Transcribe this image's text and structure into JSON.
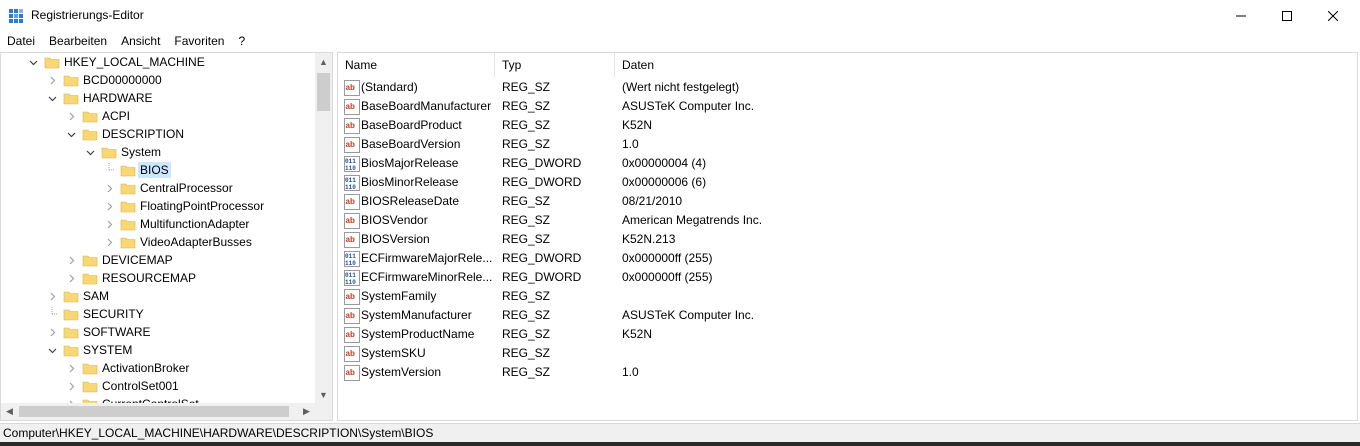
{
  "window": {
    "title": "Registrierungs-Editor",
    "icon": "regedit-icon"
  },
  "menu": [
    "Datei",
    "Bearbeiten",
    "Ansicht",
    "Favoriten",
    "?"
  ],
  "tree": {
    "items": [
      {
        "label": "HKEY_LOCAL_MACHINE",
        "level": 1,
        "state": "expanded"
      },
      {
        "label": "BCD00000000",
        "level": 2,
        "state": "collapsed"
      },
      {
        "label": "HARDWARE",
        "level": 2,
        "state": "expanded"
      },
      {
        "label": "ACPI",
        "level": 3,
        "state": "collapsed"
      },
      {
        "label": "DESCRIPTION",
        "level": 3,
        "state": "expanded"
      },
      {
        "label": "System",
        "level": 4,
        "state": "expanded"
      },
      {
        "label": "BIOS",
        "level": 5,
        "state": "leaf",
        "selected": true
      },
      {
        "label": "CentralProcessor",
        "level": 5,
        "state": "collapsed"
      },
      {
        "label": "FloatingPointProcessor",
        "level": 5,
        "state": "collapsed"
      },
      {
        "label": "MultifunctionAdapter",
        "level": 5,
        "state": "collapsed"
      },
      {
        "label": "VideoAdapterBusses",
        "level": 5,
        "state": "collapsed"
      },
      {
        "label": "DEVICEMAP",
        "level": 3,
        "state": "collapsed"
      },
      {
        "label": "RESOURCEMAP",
        "level": 3,
        "state": "collapsed"
      },
      {
        "label": "SAM",
        "level": 2,
        "state": "collapsed"
      },
      {
        "label": "SECURITY",
        "level": 2,
        "state": "leaf"
      },
      {
        "label": "SOFTWARE",
        "level": 2,
        "state": "collapsed"
      },
      {
        "label": "SYSTEM",
        "level": 2,
        "state": "expanded"
      },
      {
        "label": "ActivationBroker",
        "level": 3,
        "state": "collapsed"
      },
      {
        "label": "ControlSet001",
        "level": 3,
        "state": "collapsed"
      },
      {
        "label": "CurrentControlSet",
        "level": 3,
        "state": "collapsed"
      }
    ]
  },
  "values": {
    "headers": {
      "name": "Name",
      "type": "Typ",
      "data": "Daten"
    },
    "rows": [
      {
        "name": "(Standard)",
        "type": "REG_SZ",
        "data": "(Wert nicht festgelegt)",
        "icon": "string-value-icon"
      },
      {
        "name": "BaseBoardManufacturer",
        "type": "REG_SZ",
        "data": "ASUSTeK Computer Inc.",
        "icon": "string-value-icon"
      },
      {
        "name": "BaseBoardProduct",
        "type": "REG_SZ",
        "data": "K52N",
        "icon": "string-value-icon"
      },
      {
        "name": "BaseBoardVersion",
        "type": "REG_SZ",
        "data": "1.0",
        "icon": "string-value-icon"
      },
      {
        "name": "BiosMajorRelease",
        "type": "REG_DWORD",
        "data": "0x00000004 (4)",
        "icon": "binary-value-icon"
      },
      {
        "name": "BiosMinorRelease",
        "type": "REG_DWORD",
        "data": "0x00000006 (6)",
        "icon": "binary-value-icon"
      },
      {
        "name": "BIOSReleaseDate",
        "type": "REG_SZ",
        "data": "08/21/2010",
        "icon": "string-value-icon"
      },
      {
        "name": "BIOSVendor",
        "type": "REG_SZ",
        "data": "American Megatrends Inc.",
        "icon": "string-value-icon"
      },
      {
        "name": "BIOSVersion",
        "type": "REG_SZ",
        "data": "K52N.213",
        "icon": "string-value-icon"
      },
      {
        "name": "ECFirmwareMajorRele...",
        "type": "REG_DWORD",
        "data": "0x000000ff (255)",
        "icon": "binary-value-icon"
      },
      {
        "name": "ECFirmwareMinorRele...",
        "type": "REG_DWORD",
        "data": "0x000000ff (255)",
        "icon": "binary-value-icon"
      },
      {
        "name": "SystemFamily",
        "type": "REG_SZ",
        "data": "",
        "icon": "string-value-icon"
      },
      {
        "name": "SystemManufacturer",
        "type": "REG_SZ",
        "data": "ASUSTeK Computer Inc.",
        "icon": "string-value-icon"
      },
      {
        "name": "SystemProductName",
        "type": "REG_SZ",
        "data": "K52N",
        "icon": "string-value-icon"
      },
      {
        "name": "SystemSKU",
        "type": "REG_SZ",
        "data": "",
        "icon": "string-value-icon"
      },
      {
        "name": "SystemVersion",
        "type": "REG_SZ",
        "data": "1.0",
        "icon": "string-value-icon"
      }
    ]
  },
  "statusbar": {
    "path": "Computer\\HKEY_LOCAL_MACHINE\\HARDWARE\\DESCRIPTION\\System\\BIOS"
  },
  "colors": {
    "selection": "#cce8ff",
    "folder": "#f8d775",
    "string_icon": "#c0392b",
    "binary_icon": "#1f4e9e"
  }
}
